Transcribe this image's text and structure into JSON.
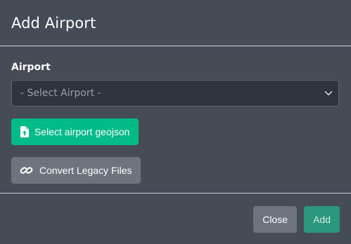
{
  "dialog": {
    "title": "Add Airport"
  },
  "form": {
    "airport_label": "Airport",
    "airport_select": {
      "selected": "- Select Airport -"
    }
  },
  "buttons": {
    "select_geojson": "Select airport geojson",
    "convert_legacy": "Convert Legacy Files",
    "close": "Close",
    "add": "Add"
  },
  "icons": {
    "select_geojson": "file-upload-icon",
    "convert_legacy": "link-icon",
    "select_dropdown": "chevron-down-icon"
  },
  "colors": {
    "background": "#454c55",
    "primary": "#00bb87",
    "secondary": "#6c757d",
    "add_button": "#2a977a",
    "select_background": "#2f343b"
  }
}
